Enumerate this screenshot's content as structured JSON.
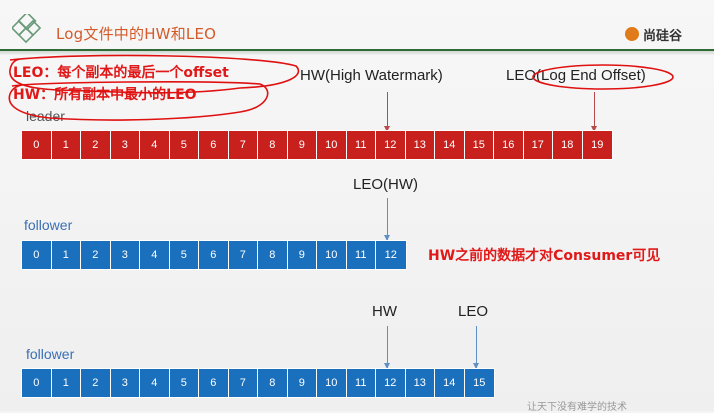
{
  "header": {
    "title": "Log文件中的HW和LEO",
    "brand": "尚硅谷",
    "colors": {
      "rule": "#2f6a37",
      "title": "#d45a2a",
      "brand_mark": "#e07a1b"
    }
  },
  "notes": {
    "leo_def": "LEO：每个副本的最后一个offset",
    "hw_def": "HW：所有副本中最小的LEO"
  },
  "labels": {
    "hw_high_watermark": "HW(High Watermark)",
    "leo_log_end_offset": "LEO(Log End Offset)",
    "leo_hw": "LEO(HW)",
    "hw": "HW",
    "leo": "LEO",
    "visibility_note": "HW之前的数据才对Consumer可见"
  },
  "rows": [
    {
      "label": "leader",
      "color": "#c8201d",
      "offsets": [
        "0",
        "1",
        "2",
        "3",
        "4",
        "5",
        "6",
        "7",
        "8",
        "9",
        "10",
        "11",
        "12",
        "13",
        "14",
        "15",
        "16",
        "17",
        "18",
        "19"
      ]
    },
    {
      "label": "follower",
      "color": "#1b70bd",
      "offsets": [
        "0",
        "1",
        "2",
        "3",
        "4",
        "5",
        "6",
        "7",
        "8",
        "9",
        "10",
        "11",
        "12"
      ]
    },
    {
      "label": "follower",
      "color": "#1b70bd",
      "offsets": [
        "0",
        "1",
        "2",
        "3",
        "4",
        "5",
        "6",
        "7",
        "8",
        "9",
        "10",
        "11",
        "12",
        "13",
        "14",
        "15"
      ]
    }
  ],
  "watermark": "让天下没有难学的技术"
}
